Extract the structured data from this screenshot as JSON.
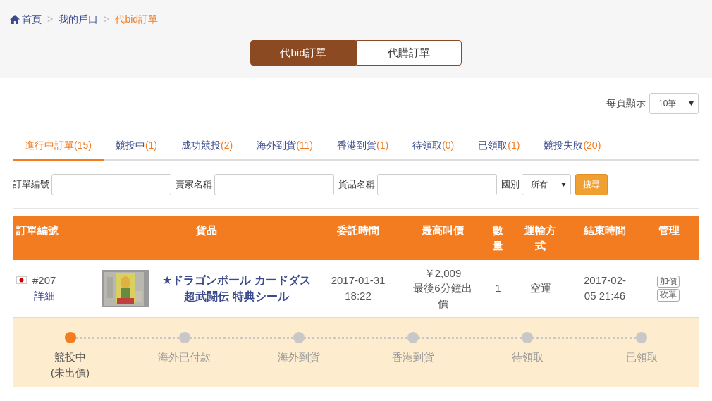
{
  "breadcrumb": [
    {
      "label": "首頁",
      "kind": "home",
      "current": false
    },
    {
      "label": "我的戶口",
      "kind": "link",
      "current": false
    },
    {
      "label": "代bid訂單",
      "kind": "link",
      "current": true
    }
  ],
  "separator": ">",
  "order_types": [
    {
      "label": "代bid訂單",
      "selected": true
    },
    {
      "label": "代購訂單",
      "selected": false
    }
  ],
  "per_page": {
    "label": "每頁顯示",
    "value": "10筆"
  },
  "tabs": [
    {
      "label": "進行中訂單",
      "count": "(15)",
      "selected": true
    },
    {
      "label": "競投中",
      "count": "(1)",
      "selected": false
    },
    {
      "label": "成功競投",
      "count": "(2)",
      "selected": false
    },
    {
      "label": "海外到貨",
      "count": "(11)",
      "selected": false
    },
    {
      "label": "香港到貨",
      "count": "(1)",
      "selected": false
    },
    {
      "label": "待領取",
      "count": "(0)",
      "selected": false
    },
    {
      "label": "已領取",
      "count": "(1)",
      "selected": false
    },
    {
      "label": "競投失敗",
      "count": "(20)",
      "selected": false
    }
  ],
  "filters": {
    "fields": [
      {
        "label": "訂單編號"
      },
      {
        "label": "賣家名稱"
      },
      {
        "label": "貨品名稱"
      }
    ],
    "country": {
      "label": "國別",
      "value": "所有"
    },
    "search_button": "搜尋"
  },
  "table": {
    "columns": [
      "訂單編號",
      "貨品",
      "委託時間",
      "最高叫價",
      "數量",
      "運輸方式",
      "結束時間",
      "管理"
    ],
    "rows": [
      {
        "order_no": "#207",
        "detail_link": "詳細",
        "image": {
          "kind": "picture"
        },
        "product_lines": [
          "★ドラゴンボール カードダス",
          "超武闘伝 特典シール"
        ],
        "commissioned": "2017-01-31 18:22",
        "price": "￥2,009",
        "price_note": "最後6分鐘出價",
        "quantity": "1",
        "shipping": "空運",
        "end_time": "2017-02-05 21:46",
        "actions": [
          "加價",
          "砍單"
        ],
        "progress": [
          {
            "label": "競投中 (未出價)",
            "selected": true
          },
          {
            "label": "海外已付款",
            "selected": false
          },
          {
            "label": "海外到貨",
            "selected": false
          },
          {
            "label": "香港到貨",
            "selected": false
          },
          {
            "label": "待領取",
            "selected": false
          },
          {
            "label": "已領取",
            "selected": false
          }
        ]
      }
    ]
  }
}
